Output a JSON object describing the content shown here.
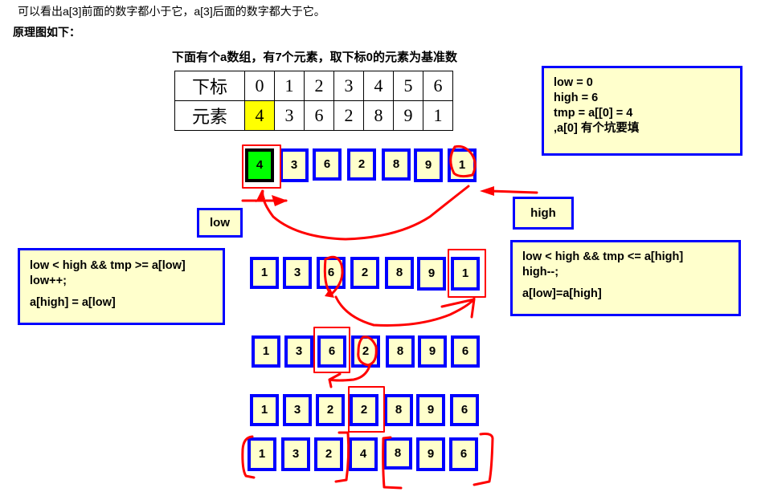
{
  "intro": {
    "line1": "可以看出a[3]前面的数字都小于它，a[3]后面的数字都大于它。",
    "line2": "原理图如下："
  },
  "caption": "下面有个a数组，有7个元素，取下标0的元素为基准数",
  "index_table": {
    "row_labels": [
      "下标",
      "元素"
    ],
    "indices": [
      "0",
      "1",
      "2",
      "3",
      "4",
      "5",
      "6"
    ],
    "elements": [
      "4",
      "3",
      "6",
      "2",
      "8",
      "9",
      "1"
    ],
    "highlight_index": 0,
    "highlight_color": "#ffff00"
  },
  "notes": {
    "init": [
      "low = 0",
      "high = 6",
      "tmp = a[[0] = 4",
      ",a[0] 有个坑要填"
    ],
    "left_scan": [
      "low < high  &&  tmp >= a[low]",
      "low++;",
      "a[high] = a[low]"
    ],
    "right_scan": [
      "low < high  &&  tmp <= a[high]",
      "high--;",
      "a[low]=a[high]"
    ]
  },
  "pointers": {
    "low": "low",
    "high": "high"
  },
  "steps": [
    {
      "values": [
        "4",
        "3",
        "6",
        "2",
        "8",
        "9",
        "1"
      ],
      "pivot_index": 0,
      "boxed_index": 0,
      "circled_index": 6
    },
    {
      "values": [
        "1",
        "3",
        "6",
        "2",
        "8",
        "9",
        "1"
      ],
      "boxed_index": 6,
      "circled_index": 2
    },
    {
      "values": [
        "1",
        "3",
        "6",
        "2",
        "8",
        "9",
        "6"
      ],
      "boxed_index": 2,
      "circled_index": 3
    },
    {
      "values": [
        "1",
        "3",
        "2",
        "2",
        "8",
        "9",
        "6"
      ],
      "boxed_index": 3
    },
    {
      "values": [
        "1",
        "3",
        "2",
        "4",
        "8",
        "9",
        "6"
      ],
      "partitions": [
        [
          0,
          2
        ],
        [
          4,
          6
        ]
      ]
    }
  ],
  "colors": {
    "cell_fill": "#ffffcc",
    "cell_border": "#0000ff",
    "pivot_fill": "#00ff00",
    "annotation": "#ff0000"
  }
}
